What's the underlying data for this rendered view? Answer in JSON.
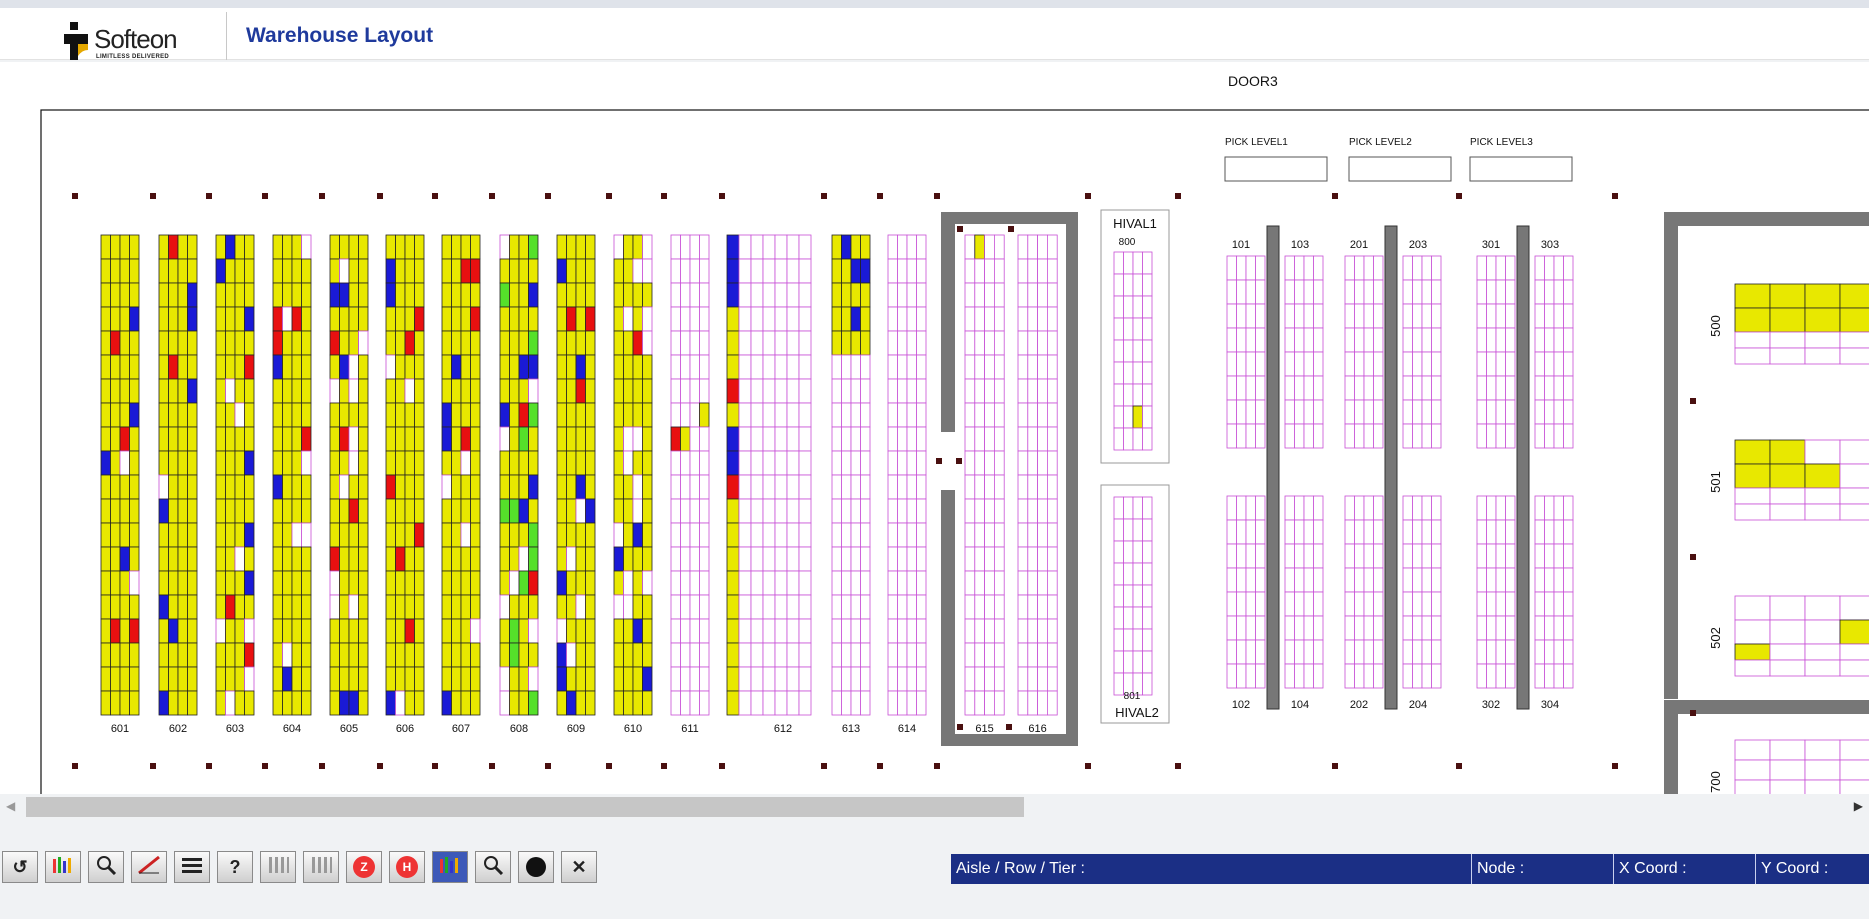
{
  "app": {
    "logo_text": "Softeon",
    "logo_tagline": "LIMITLESS DELIVERED",
    "title": "Warehouse Layout"
  },
  "layout": {
    "door_label": "DOOR3",
    "pick_levels": [
      "PICK LEVEL1",
      "PICK LEVEL2",
      "PICK LEVEL3"
    ],
    "aisles": [
      {
        "label": "601"
      },
      {
        "label": "602"
      },
      {
        "label": "603"
      },
      {
        "label": "604"
      },
      {
        "label": "605"
      },
      {
        "label": "606"
      },
      {
        "label": "607"
      },
      {
        "label": "608"
      },
      {
        "label": "609"
      },
      {
        "label": "610"
      },
      {
        "label": "611"
      },
      {
        "label": "612"
      },
      {
        "label": "613"
      },
      {
        "label": "614"
      },
      {
        "label": "615"
      },
      {
        "label": "616"
      }
    ],
    "hival": [
      {
        "name": "HIVAL1",
        "code": "800"
      },
      {
        "name": "HIVAL2",
        "code": "801"
      }
    ],
    "pick_aisles": [
      {
        "top_left": "101",
        "top_right": "103",
        "bottom_left": "102",
        "bottom_right": "104"
      },
      {
        "top_left": "201",
        "top_right": "203",
        "bottom_left": "202",
        "bottom_right": "204"
      },
      {
        "top_left": "301",
        "top_right": "303",
        "bottom_left": "302",
        "bottom_right": "304"
      }
    ],
    "right_zones": [
      "500",
      "501",
      "502",
      "700"
    ],
    "legend_colors": {
      "occupied": "#e8e800",
      "blue": "#1a1ad6",
      "red": "#e81010",
      "green": "#55e02a",
      "empty_grid": "#c84fd6"
    }
  },
  "toolbar": {
    "buttons": [
      {
        "name": "refresh-icon",
        "glyph": "↺"
      },
      {
        "name": "color-chart-icon",
        "glyph": ""
      },
      {
        "name": "zoom-icon",
        "glyph": ""
      },
      {
        "name": "ruler-icon",
        "glyph": ""
      },
      {
        "name": "list-icon",
        "glyph": ""
      },
      {
        "name": "help-icon",
        "glyph": "?"
      },
      {
        "name": "grid-icon",
        "glyph": ""
      },
      {
        "name": "columns-icon",
        "glyph": ""
      },
      {
        "name": "z-badge-icon",
        "glyph": "Z"
      },
      {
        "name": "h-badge-icon",
        "glyph": "H"
      },
      {
        "name": "chart-active-icon",
        "glyph": ""
      },
      {
        "name": "search-icon",
        "glyph": ""
      },
      {
        "name": "user-icon",
        "glyph": ""
      },
      {
        "name": "close-icon",
        "glyph": "✕"
      }
    ]
  },
  "status": {
    "aisle_row_tier": "Aisle / Row / Tier :",
    "node": "Node :",
    "x_coord": "X Coord :",
    "y_coord": "Y Coord :"
  }
}
